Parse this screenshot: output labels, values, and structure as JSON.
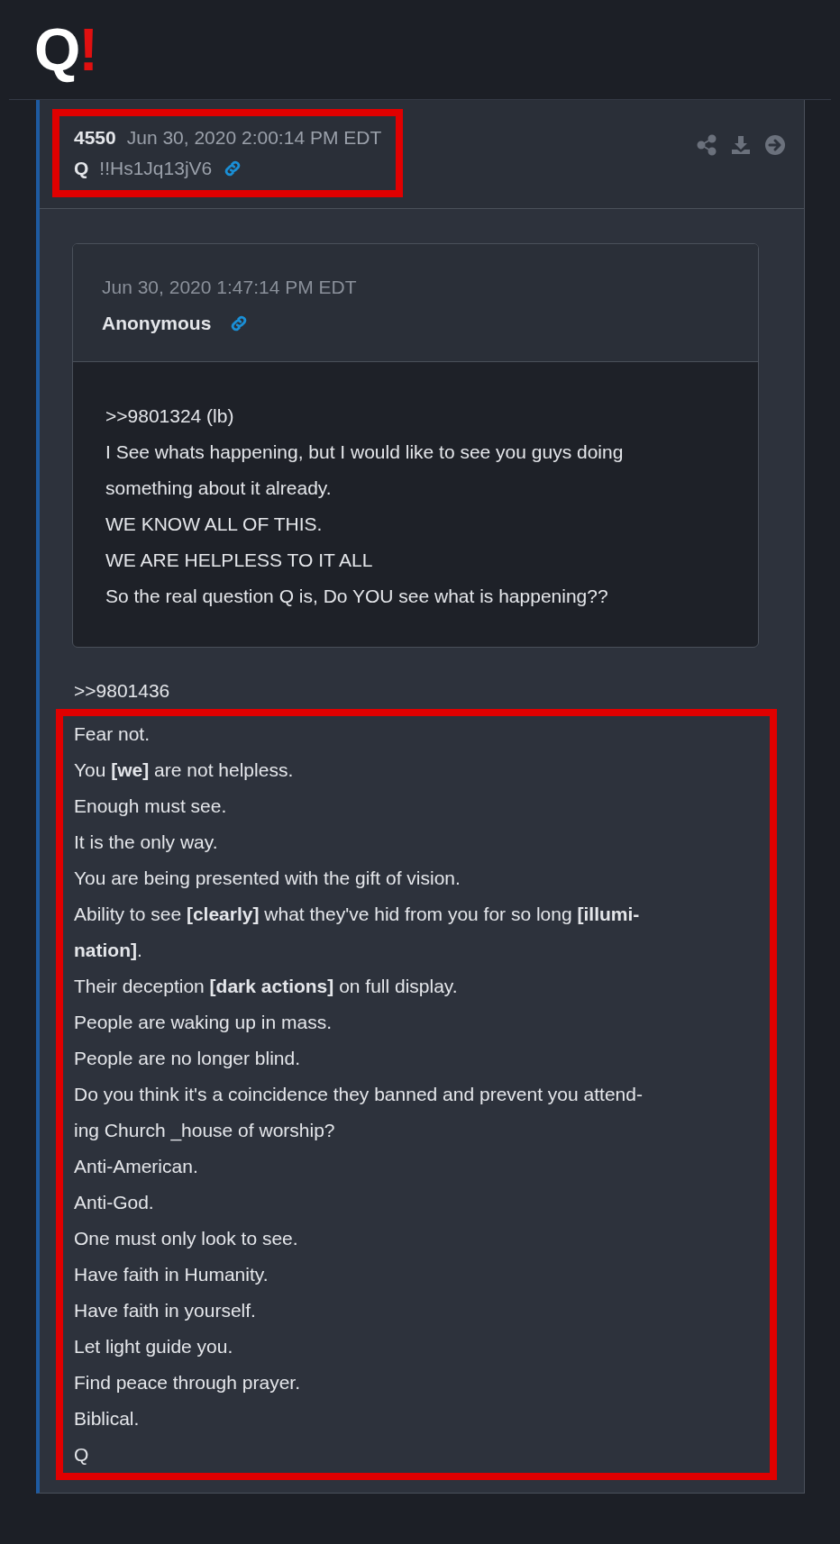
{
  "logo": {
    "letter": "Q",
    "mark": "!"
  },
  "post": {
    "number": "4550",
    "date": "Jun 30, 2020 2:00:14 PM EDT",
    "author": "Q",
    "tripcode": "!!Hs1Jq13jV6",
    "highlighted": true,
    "quote": {
      "date": "Jun 30, 2020 1:47:14 PM EDT",
      "author": "Anonymous",
      "lines": [
        ">>9801324 (lb)",
        "I See whats happening, but I would like to see you guys doing",
        "something about it already.",
        "WE KNOW ALL OF THIS.",
        "WE ARE HELPLESS TO IT ALL",
        "So the real question Q is, Do YOU see what is happening??"
      ]
    },
    "reply_ref": ">>9801436",
    "body_highlighted": true,
    "body": [
      "Fear not.",
      "You **[we]** are not helpless.",
      "Enough must see.",
      "It is the only way.",
      "You are being presented with the gift of vision.",
      "Ability to see **[clearly]** what they've hid from you for so long **[illumi-**",
      "**nation]**.",
      "Their deception **[dark actions]** on full display.",
      "People are waking up in mass.",
      "People are no longer blind.",
      "Do you think it's a coincidence they banned and prevent you attend-",
      "ing Church _house of worship?",
      "Anti-American.",
      "Anti-God.",
      "One must only look to see.",
      "Have faith in Humanity.",
      "Have faith in yourself.",
      "Let light guide you.",
      "Find peace through prayer.",
      "Biblical.",
      "Q"
    ]
  }
}
